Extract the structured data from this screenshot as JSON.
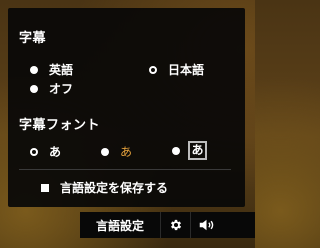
{
  "subtitles": {
    "heading": "字幕",
    "options": [
      {
        "label": "英語",
        "selected": false
      },
      {
        "label": "日本語",
        "selected": true
      },
      {
        "label": "オフ",
        "selected": false
      }
    ]
  },
  "subtitle_font": {
    "heading": "字幕フォント",
    "options": [
      {
        "label": "あ",
        "style": "plain-white",
        "selected": true
      },
      {
        "label": "あ",
        "style": "yellow",
        "selected": false
      },
      {
        "label": "あ",
        "style": "boxed",
        "selected": false
      }
    ]
  },
  "save_language": {
    "label": "言語設定を保存する",
    "checked": true
  },
  "control_bar": {
    "language_button": "言語設定",
    "settings_icon": "gear-icon",
    "volume_icon": "speaker-icon"
  },
  "colors": {
    "panel_bg": "#080808",
    "font_yellow": "#e6a23c",
    "text": "#ffffff"
  }
}
